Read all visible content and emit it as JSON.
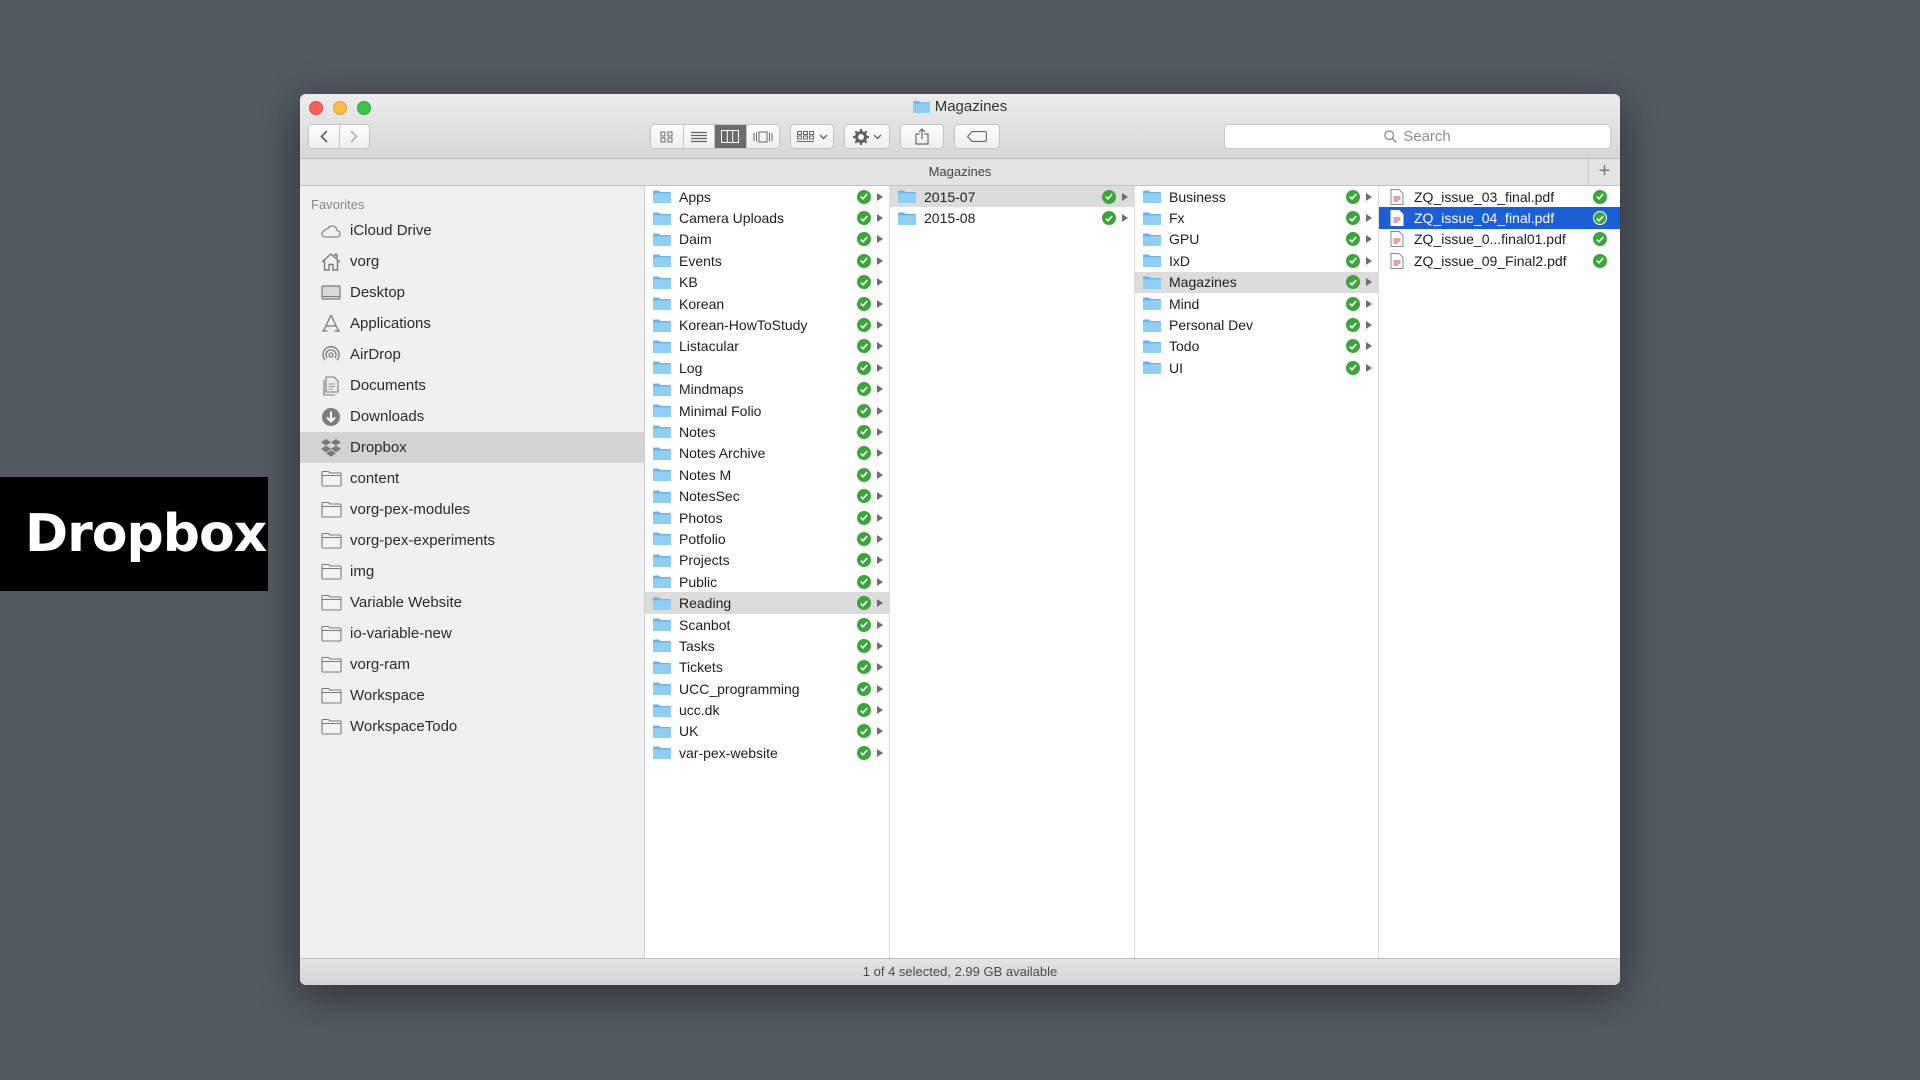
{
  "banner": {
    "text": "Dropbox"
  },
  "window": {
    "title": "Magazines"
  },
  "toolbar": {
    "search_placeholder": "Search"
  },
  "pathbar": {
    "title": "Magazines",
    "add_label": "+"
  },
  "sidebar": {
    "heading": "Favorites",
    "items": [
      {
        "label": "iCloud Drive",
        "icon": "cloud-icon"
      },
      {
        "label": "vorg",
        "icon": "home-icon"
      },
      {
        "label": "Desktop",
        "icon": "desktop-icon"
      },
      {
        "label": "Applications",
        "icon": "applications-icon"
      },
      {
        "label": "AirDrop",
        "icon": "airdrop-icon"
      },
      {
        "label": "Documents",
        "icon": "documents-icon"
      },
      {
        "label": "Downloads",
        "icon": "downloads-icon"
      },
      {
        "label": "Dropbox",
        "icon": "dropbox-icon",
        "selected": true
      },
      {
        "label": "content",
        "icon": "folder-icon"
      },
      {
        "label": "vorg-pex-modules",
        "icon": "folder-icon"
      },
      {
        "label": "vorg-pex-experiments",
        "icon": "folder-icon"
      },
      {
        "label": "img",
        "icon": "folder-icon"
      },
      {
        "label": "Variable Website",
        "icon": "folder-icon"
      },
      {
        "label": "io-variable-new",
        "icon": "folder-icon"
      },
      {
        "label": "vorg-ram",
        "icon": "folder-icon"
      },
      {
        "label": "Workspace",
        "icon": "folder-icon"
      },
      {
        "label": "WorkspaceTodo",
        "icon": "folder-icon"
      }
    ]
  },
  "columns": {
    "col1": [
      "Apps",
      "Camera Uploads",
      "Daim",
      "Events",
      "KB",
      "Korean",
      "Korean-HowToStudy",
      "Listacular",
      "Log",
      "Mindmaps",
      "Minimal Folio",
      "Notes",
      "Notes Archive",
      "Notes M",
      "NotesSec",
      "Photos",
      "Potfolio",
      "Projects",
      "Public",
      "Reading",
      "Scanbot",
      "Tasks",
      "Tickets",
      "UCC_programming",
      "ucc.dk",
      "UK",
      "var-pex-website"
    ],
    "col1_selected": "Reading",
    "col2": [
      "2015-07",
      "2015-08"
    ],
    "col2_selected": "2015-07",
    "col3": [
      "Business",
      "Fx",
      "GPU",
      "IxD",
      "Magazines",
      "Mind",
      "Personal Dev",
      "Todo",
      "UI"
    ],
    "col3_selected": "Magazines",
    "col4": [
      "ZQ_issue_03_final.pdf",
      "ZQ_issue_04_final.pdf",
      "ZQ_issue_0...final01.pdf",
      "ZQ_issue_09_Final2.pdf"
    ],
    "col4_selected": "ZQ_issue_04_final.pdf"
  },
  "status": {
    "text": "1 of 4 selected, 2.99 GB available"
  },
  "colors": {
    "selection_blue": "#1b5fd6",
    "sync_green": "#3ba43b",
    "folder_blue": "#7cc4f2"
  }
}
